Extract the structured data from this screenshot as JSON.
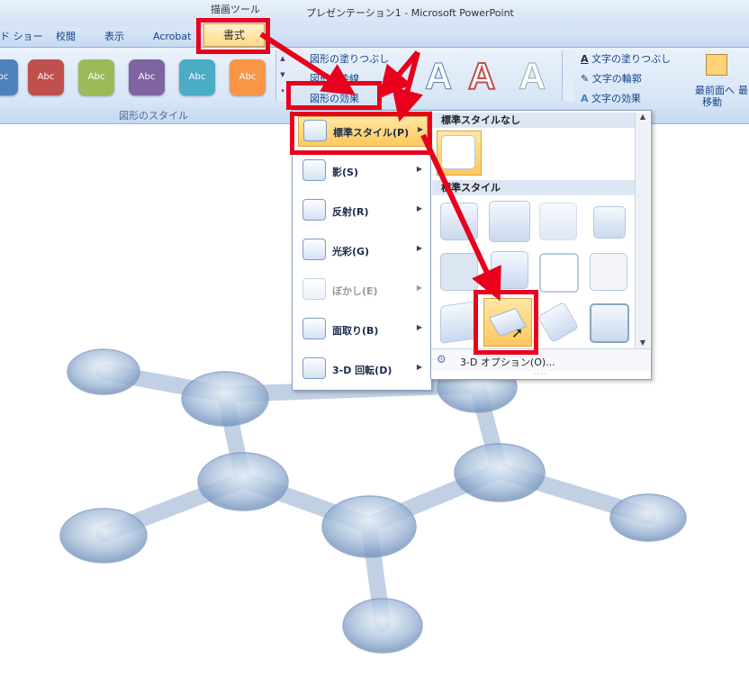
{
  "title_bar": {
    "context_label": "描画ツール",
    "title": "プレゼンテーション1 - Microsoft PowerPoint"
  },
  "tabs": [
    {
      "label": "ド ショー"
    },
    {
      "label": "校閲"
    },
    {
      "label": "表示"
    },
    {
      "label": "Acrobat"
    }
  ],
  "active_tab": {
    "label": "書式"
  },
  "ribbon": {
    "shape_styles": {
      "swatches": [
        {
          "label": "Abc",
          "color": "#4f81bd"
        },
        {
          "label": "Abc",
          "color": "#c0504d"
        },
        {
          "label": "Abc",
          "color": "#9bbb59"
        },
        {
          "label": "Abc",
          "color": "#8064a2"
        },
        {
          "label": "Abc",
          "color": "#4bacc6"
        },
        {
          "label": "Abc",
          "color": "#f79646"
        }
      ],
      "fill_label": "図形の塗りつぶし",
      "outline_label": "図形の枠線",
      "effects_label": "図形の効果",
      "group_label": "図形のスタイル"
    },
    "wordart": {
      "letters": [
        "A",
        "A",
        "A"
      ],
      "text_fill_label": "文字の塗りつぶし",
      "text_outline_label": "文字の輪郭",
      "text_effects_label": "文字の効果"
    },
    "arrange": {
      "bring_front_label_line1": "最前面へ",
      "bring_front_label_line2": "移動",
      "next_label": "最"
    }
  },
  "effects_menu": {
    "items": [
      {
        "label": "標準スタイル(P)"
      },
      {
        "label": "影(S)"
      },
      {
        "label": "反射(R)"
      },
      {
        "label": "光彩(G)"
      },
      {
        "label": "ぼかし(E)"
      },
      {
        "label": "面取り(B)"
      },
      {
        "label": "3-D 回転(D)"
      }
    ]
  },
  "preset_gallery": {
    "no_preset_header": "標準スタイルなし",
    "presets_header": "標準スタイル",
    "options_label": "3-D オプション(O)..."
  },
  "colors": {
    "highlight": "#e8001c",
    "accent_orange": "#ffc85a",
    "ribbon_blue": "#d7e5f6"
  }
}
